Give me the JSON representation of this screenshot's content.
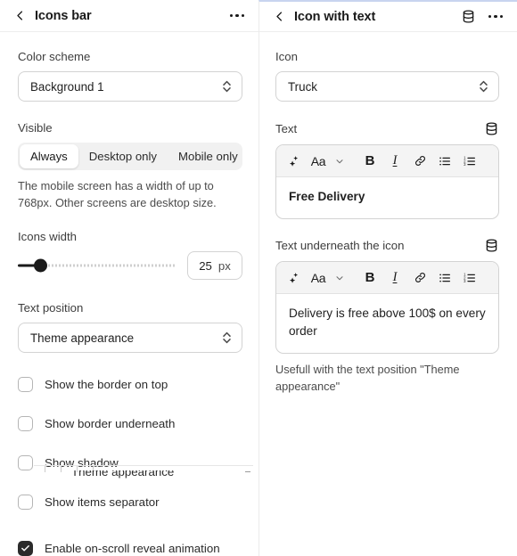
{
  "left_panel": {
    "header": {
      "back_icon": "chevron-left-icon",
      "title": "Icons bar",
      "overflow_icon": "ellipsis-icon"
    },
    "color_scheme": {
      "label": "Color scheme",
      "value": "Background 1"
    },
    "visible": {
      "label": "Visible",
      "options": [
        "Always",
        "Desktop only",
        "Mobile only"
      ],
      "selected": "Always",
      "help": "The mobile screen has a width of up to 768px. Other screens are desktop size."
    },
    "icons_width": {
      "label": "Icons width",
      "value": "25",
      "unit": "px",
      "slider_percent": 11
    },
    "text_position": {
      "label": "Text position",
      "value": "Theme appearance"
    },
    "checkboxes": [
      {
        "label": "Show the border on top",
        "checked": false
      },
      {
        "label": "Show border underneath",
        "checked": false
      },
      {
        "label": "Show shadow",
        "checked": false
      },
      {
        "label": "Show items separator",
        "checked": false
      },
      {
        "label": "Enable on-scroll reveal animation",
        "checked": true
      }
    ],
    "ghost_artifact": {
      "text": "Theme appearance"
    }
  },
  "right_panel": {
    "header": {
      "back_icon": "chevron-left-icon",
      "title": "Icon with text",
      "database_icon": "database-icon",
      "overflow_icon": "ellipsis-icon"
    },
    "icon_field": {
      "label": "Icon",
      "value": "Truck"
    },
    "text_field": {
      "label": "Text",
      "database_icon": "database-icon",
      "content": "Free Delivery",
      "bold": true
    },
    "text_underneath_field": {
      "label": "Text underneath the icon",
      "database_icon": "database-icon",
      "content": "Delivery is free above 100$ on every order",
      "help": "Usefull with the text position \"Theme appearance\""
    },
    "toolbar": {
      "buttons": [
        "sparkle-ai-icon",
        "font-size-aa-icon",
        "chevron-down-icon",
        "bold-icon",
        "italic-icon",
        "link-icon",
        "bulleted-list-icon",
        "numbered-list-icon"
      ],
      "aa_label": "Aa",
      "bold_label": "B",
      "italic_label": "I"
    }
  },
  "colors": {
    "accent_border_top": "#c8d4ef",
    "checkbox_checked": "#2b2b2b",
    "segmented_bg": "#f1f1f1",
    "toolbar_bg": "#f4f4f4"
  }
}
